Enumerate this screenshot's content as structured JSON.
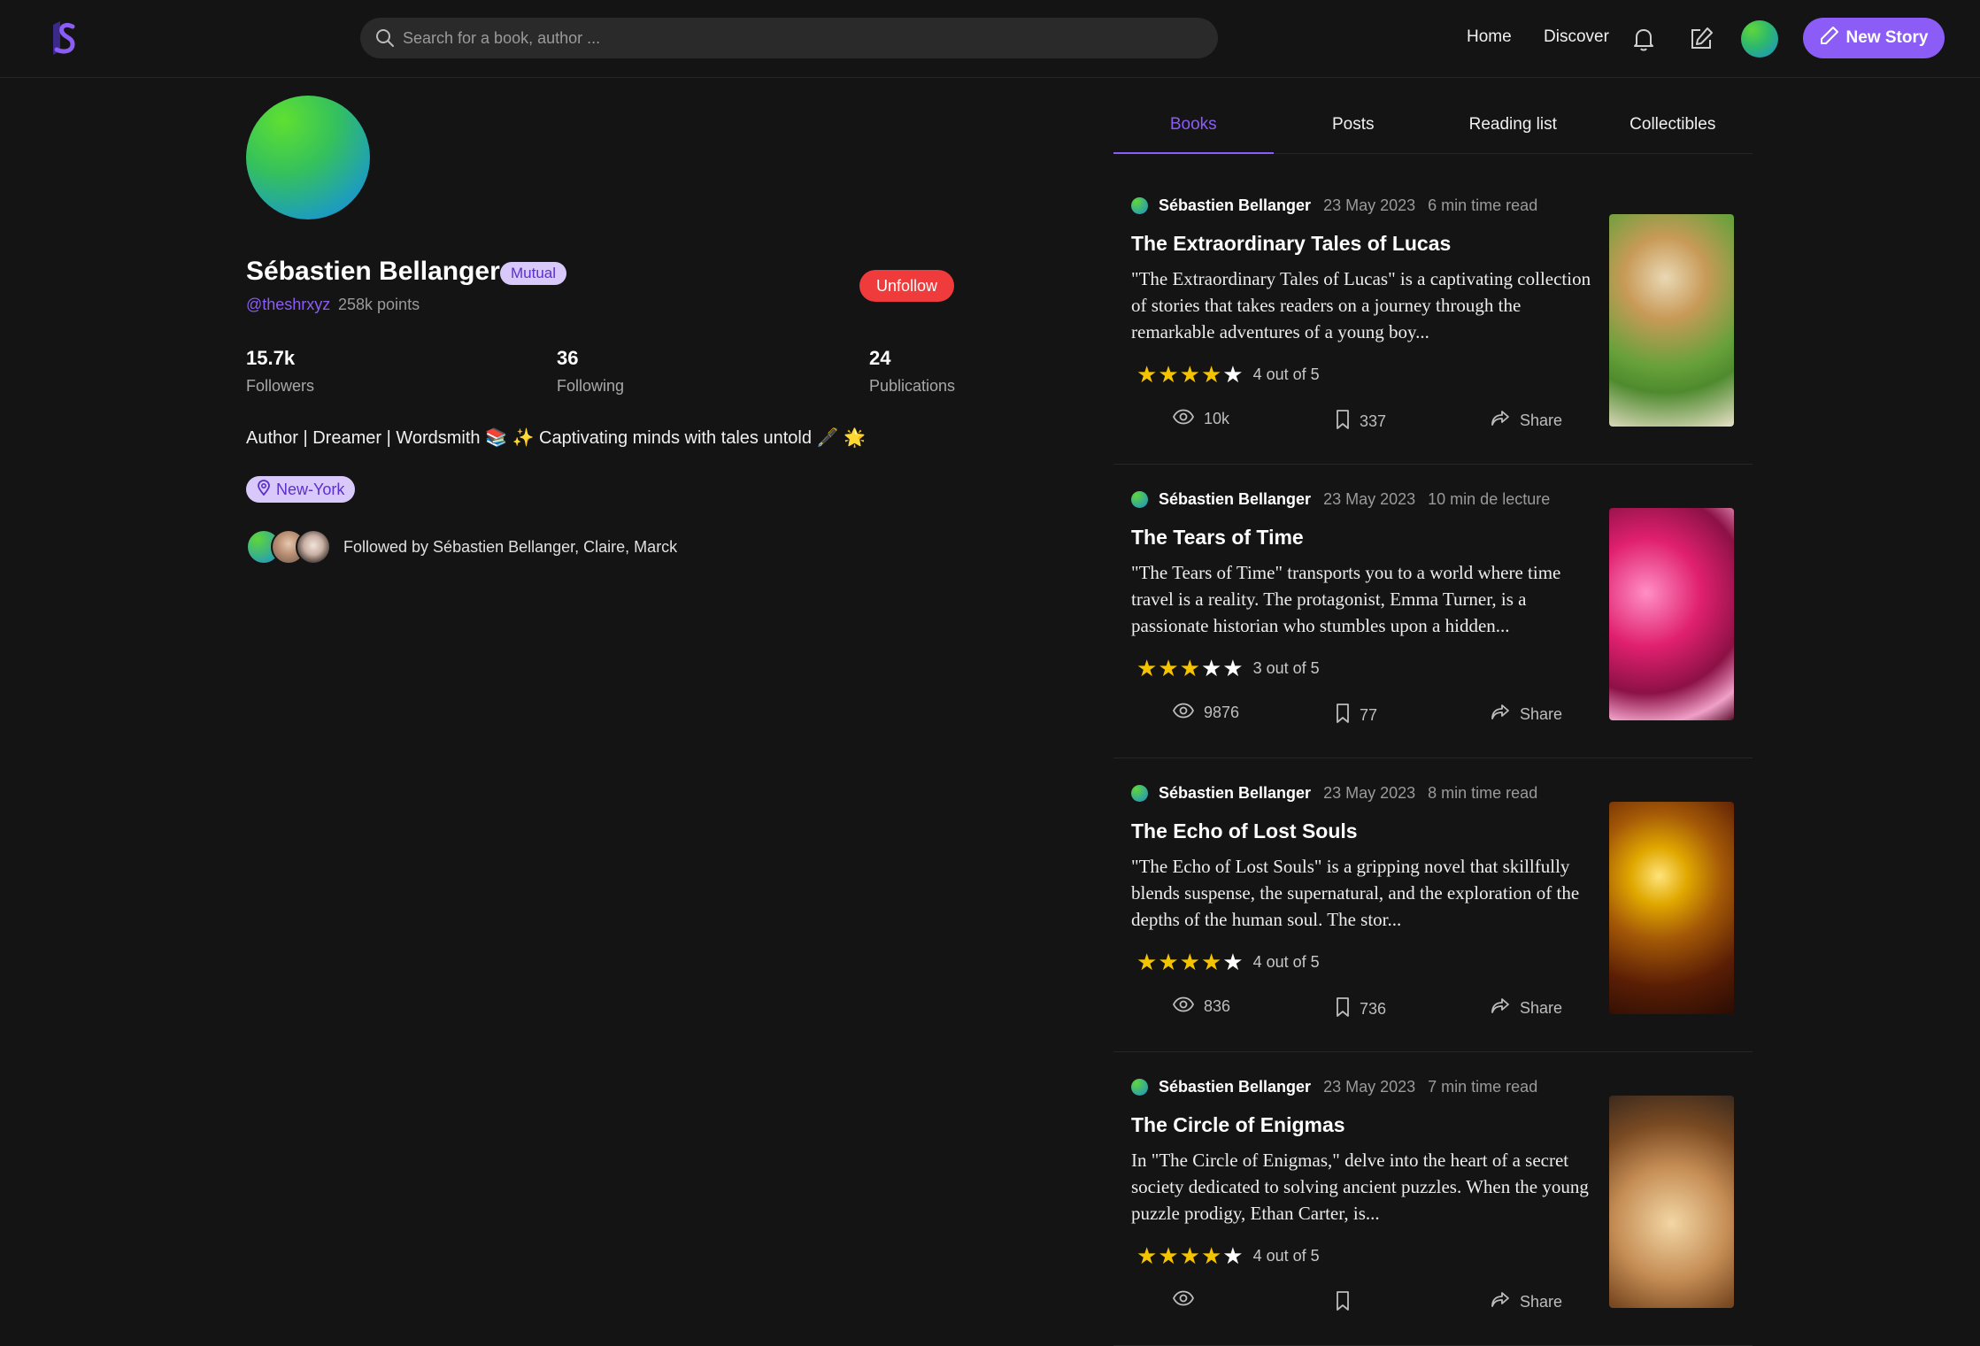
{
  "header": {
    "search_placeholder": "Search for a book, author ...",
    "nav": {
      "home": "Home",
      "discover": "Discover"
    },
    "new_story_label": "New Story",
    "icons": [
      "logo-icon",
      "search-icon",
      "bell-icon",
      "edit-icon",
      "pencil-icon"
    ]
  },
  "profile": {
    "name": "Sébastien Bellanger",
    "badge": "Mutual",
    "handle": "@theshrxyz",
    "points": "258k points",
    "unfollow_label": "Unfollow",
    "stats": {
      "followers": {
        "value": "15.7k",
        "label": "Followers"
      },
      "following": {
        "value": "36",
        "label": "Following"
      },
      "publications": {
        "value": "24",
        "label": "Publications"
      }
    },
    "bio": "Author | Dreamer | Wordsmith 📚 ✨ Captivating minds with tales untold 🖋️ 🌟",
    "location": "New-York",
    "followed_by": "Followed by Sébastien Bellanger, Claire, Marck"
  },
  "tabs": [
    {
      "label": "Books",
      "active": true
    },
    {
      "label": "Posts",
      "active": false
    },
    {
      "label": "Reading list",
      "active": false
    },
    {
      "label": "Collectibles",
      "active": false
    }
  ],
  "books": [
    {
      "author": "Sébastien Bellanger",
      "date": "23 May 2023",
      "read_time": "6 min time read",
      "title": "The Extraordinary Tales of Lucas",
      "description": "\"The Extraordinary Tales of Lucas\" is a captivating collection of stories that takes readers on a journey through the remarkable adventures of a young boy...",
      "rating": 4,
      "rating_text": "4 out of 5",
      "views": "10k",
      "saves": "337",
      "share_label": "Share"
    },
    {
      "author": "Sébastien Bellanger",
      "date": "23 May 2023",
      "read_time": "10 min de lecture",
      "title": "The Tears of Time",
      "description": "\"The Tears of Time\" transports you to a world where time travel is a reality. The protagonist, Emma Turner, is a passionate historian who stumbles upon a hidden...",
      "rating": 3,
      "rating_text": "3 out of 5",
      "views": "9876",
      "saves": "77",
      "share_label": "Share"
    },
    {
      "author": "Sébastien Bellanger",
      "date": "23 May 2023",
      "read_time": "8 min time read",
      "title": "The Echo of Lost Souls",
      "description": "\"The Echo of Lost Souls\" is a gripping novel that skillfully blends suspense, the supernatural, and the exploration of the depths of the human soul. The stor...",
      "rating": 4,
      "rating_text": "4 out of 5",
      "views": "836",
      "saves": "736",
      "share_label": "Share"
    },
    {
      "author": "Sébastien Bellanger",
      "date": "23 May 2023",
      "read_time": "7 min time read",
      "title": "The Circle of Enigmas",
      "description": "In \"The Circle of Enigmas,\" delve into the heart of a secret society dedicated to solving ancient puzzles. When the young puzzle prodigy, Ethan Carter, is...",
      "rating": 4,
      "rating_text": "4 out of 5",
      "views": "",
      "saves": "",
      "share_label": "Share"
    }
  ],
  "colors": {
    "background": "#141414",
    "accent": "#8b5cf6",
    "danger": "#ef3b3b",
    "badge_bg": "#d9c9fb",
    "star": "#f5c400"
  }
}
